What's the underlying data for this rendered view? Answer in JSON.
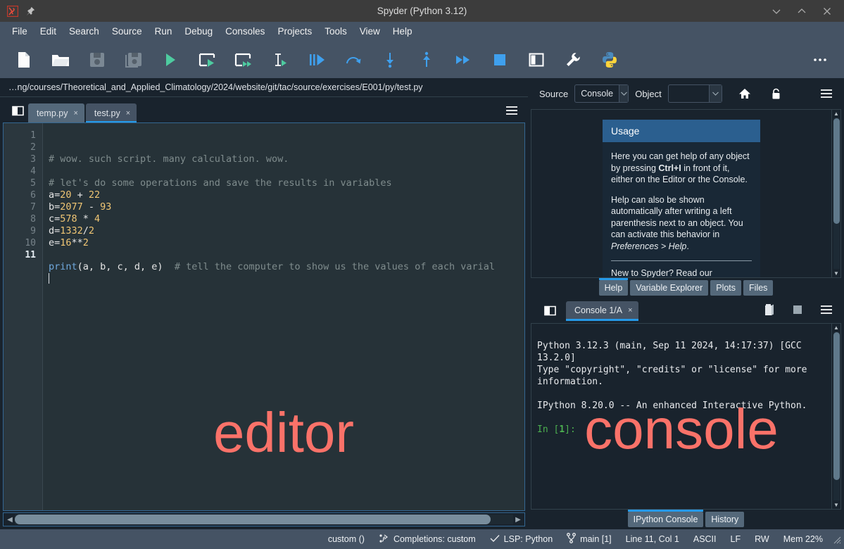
{
  "window": {
    "title": "Spyder (Python 3.12)",
    "logo_icon": "spyder-logo-icon",
    "pin_icon": "pin-icon",
    "minimize_icon": "chevron-down-icon",
    "maximize_icon": "chevron-up-icon",
    "close_icon": "close-icon"
  },
  "menubar": {
    "items": [
      {
        "label": "File"
      },
      {
        "label": "Edit"
      },
      {
        "label": "Search"
      },
      {
        "label": "Source"
      },
      {
        "label": "Run"
      },
      {
        "label": "Debug"
      },
      {
        "label": "Consoles"
      },
      {
        "label": "Projects"
      },
      {
        "label": "Tools"
      },
      {
        "label": "View"
      },
      {
        "label": "Help"
      }
    ]
  },
  "toolbar": {
    "buttons": [
      {
        "name": "new-file-icon",
        "tooltip": "New file"
      },
      {
        "name": "open-file-icon",
        "tooltip": "Open file"
      },
      {
        "name": "save-file-icon",
        "tooltip": "Save file"
      },
      {
        "name": "save-all-icon",
        "tooltip": "Save all"
      },
      {
        "name": "run-file-icon",
        "tooltip": "Run file"
      },
      {
        "name": "run-cell-icon",
        "tooltip": "Run current cell"
      },
      {
        "name": "run-cell-advance-icon",
        "tooltip": "Run cell and advance"
      },
      {
        "name": "run-selection-icon",
        "tooltip": "Run selection"
      },
      {
        "name": "debug-file-icon",
        "tooltip": "Debug file"
      },
      {
        "name": "step-over-icon",
        "tooltip": "Run current line"
      },
      {
        "name": "step-into-icon",
        "tooltip": "Step into function"
      },
      {
        "name": "step-return-icon",
        "tooltip": "Run until current function returns"
      },
      {
        "name": "continue-icon",
        "tooltip": "Continue execution"
      },
      {
        "name": "stop-debug-icon",
        "tooltip": "Stop debugging"
      },
      {
        "name": "maximize-pane-icon",
        "tooltip": "Maximize current pane"
      },
      {
        "name": "preferences-icon",
        "tooltip": "Preferences"
      },
      {
        "name": "python-path-icon",
        "tooltip": "Python interpreter"
      },
      {
        "name": "toolbar-overflow-icon",
        "tooltip": "More"
      }
    ]
  },
  "editor": {
    "path": "…ng/courses/Theoretical_and_Applied_Climatology/2024/website/git/tac/source/exercises/E001/py/test.py",
    "browse_icon": "browse-tabs-icon",
    "options_icon": "hamburger-menu-icon",
    "tabs": [
      {
        "label": "temp.py",
        "close": "×",
        "active": false
      },
      {
        "label": "test.py",
        "close": "×",
        "active": true
      }
    ],
    "line_numbers": [
      "1",
      "2",
      "3",
      "4",
      "5",
      "6",
      "7",
      "8",
      "9",
      "10",
      "11"
    ],
    "current_line": 11,
    "watermark": "editor",
    "code_lines": [
      {
        "n": 1,
        "tokens": [
          {
            "t": "# wow. such script. many calculation. wow.",
            "c": "cm"
          }
        ]
      },
      {
        "n": 2,
        "tokens": []
      },
      {
        "n": 3,
        "tokens": [
          {
            "t": "# let's do some operations and save the results in variables",
            "c": "cm"
          }
        ]
      },
      {
        "n": 4,
        "tokens": [
          {
            "t": "a=",
            "c": "op"
          },
          {
            "t": "20",
            "c": "num"
          },
          {
            "t": " + ",
            "c": "op"
          },
          {
            "t": "22",
            "c": "num"
          }
        ]
      },
      {
        "n": 5,
        "tokens": [
          {
            "t": "b=",
            "c": "op"
          },
          {
            "t": "2077",
            "c": "num"
          },
          {
            "t": " - ",
            "c": "op"
          },
          {
            "t": "93",
            "c": "num"
          }
        ]
      },
      {
        "n": 6,
        "tokens": [
          {
            "t": "c=",
            "c": "op"
          },
          {
            "t": "578",
            "c": "num"
          },
          {
            "t": " * ",
            "c": "op"
          },
          {
            "t": "4",
            "c": "num"
          }
        ]
      },
      {
        "n": 7,
        "tokens": [
          {
            "t": "d=",
            "c": "op"
          },
          {
            "t": "1332",
            "c": "num"
          },
          {
            "t": "/",
            "c": "op"
          },
          {
            "t": "2",
            "c": "num"
          }
        ]
      },
      {
        "n": 8,
        "tokens": [
          {
            "t": "e=",
            "c": "op"
          },
          {
            "t": "16",
            "c": "num"
          },
          {
            "t": "**",
            "c": "op"
          },
          {
            "t": "2",
            "c": "num"
          }
        ]
      },
      {
        "n": 9,
        "tokens": []
      },
      {
        "n": 10,
        "tokens": [
          {
            "t": "print",
            "c": "fn"
          },
          {
            "t": "(a, b, c, d, e)  ",
            "c": "op"
          },
          {
            "t": "# tell the computer to show us the values of each varial",
            "c": "cm"
          }
        ]
      },
      {
        "n": 11,
        "tokens": []
      }
    ]
  },
  "help": {
    "source_label": "Source",
    "source_value": "Console",
    "object_label": "Object",
    "object_value": "",
    "home_icon": "home-icon",
    "lock_icon": "lock-icon",
    "options_icon": "hamburger-menu-icon",
    "card_title": "Usage",
    "paragraph_1_a": "Here you can get help of any object by pressing ",
    "paragraph_1_b": "Ctrl+I",
    "paragraph_1_c": " in front of it, either on the Editor or the Console.",
    "paragraph_2_a": "Help can also be shown automatically after writing a left parenthesis next to an object. You can activate this behavior in ",
    "paragraph_2_b": "Preferences > Help",
    "paragraph_2_c": ".",
    "paragraph_3": "New to Spyder? Read our",
    "tabs": [
      {
        "label": "Help",
        "active": true
      },
      {
        "label": "Variable Explorer",
        "active": false
      },
      {
        "label": "Plots",
        "active": false
      },
      {
        "label": "Files",
        "active": false
      }
    ]
  },
  "console": {
    "browse_icon": "browse-tabs-icon",
    "tab_label": "Console 1/A",
    "tab_close": "×",
    "remove_icon": "trash-icon",
    "stop_icon": "stop-square-icon",
    "options_icon": "hamburger-menu-icon",
    "banner_line_1": "Python 3.12.3 (main, Sep 11 2024, 14:17:37) [GCC 13.2.0]",
    "banner_line_2": "Type \"copyright\", \"credits\" or \"license\" for more information.",
    "banner_line_3": "IPython 8.20.0 -- An enhanced Interactive Python.",
    "prompt_prefix": "In [",
    "prompt_number": "1",
    "prompt_suffix": "]:",
    "watermark": "console",
    "tabs": [
      {
        "label": "IPython Console",
        "active": true
      },
      {
        "label": "History",
        "active": false
      }
    ]
  },
  "statusbar": {
    "interpreter": "custom ()",
    "completions_icon": "completions-icon",
    "completions": "Completions: custom",
    "lsp_check_icon": "check-icon",
    "lsp": "LSP: Python",
    "branch_icon": "git-branch-icon",
    "branch": "main [1]",
    "cursor": "Line 11, Col 1",
    "encoding": "ASCII",
    "eol": "LF",
    "permissions": "RW",
    "memory": "Mem 22%"
  },
  "colors": {
    "accent": "#259ae9",
    "panel": "#455364",
    "background": "#19232d",
    "editor_bg": "#263238",
    "watermark": "#fa7269",
    "number_token": "#f0c674",
    "comment_token": "#7f8c8d",
    "function_token": "#6fa8dc",
    "prompt_green": "#4caf50",
    "help_header": "#2b5f8f"
  }
}
